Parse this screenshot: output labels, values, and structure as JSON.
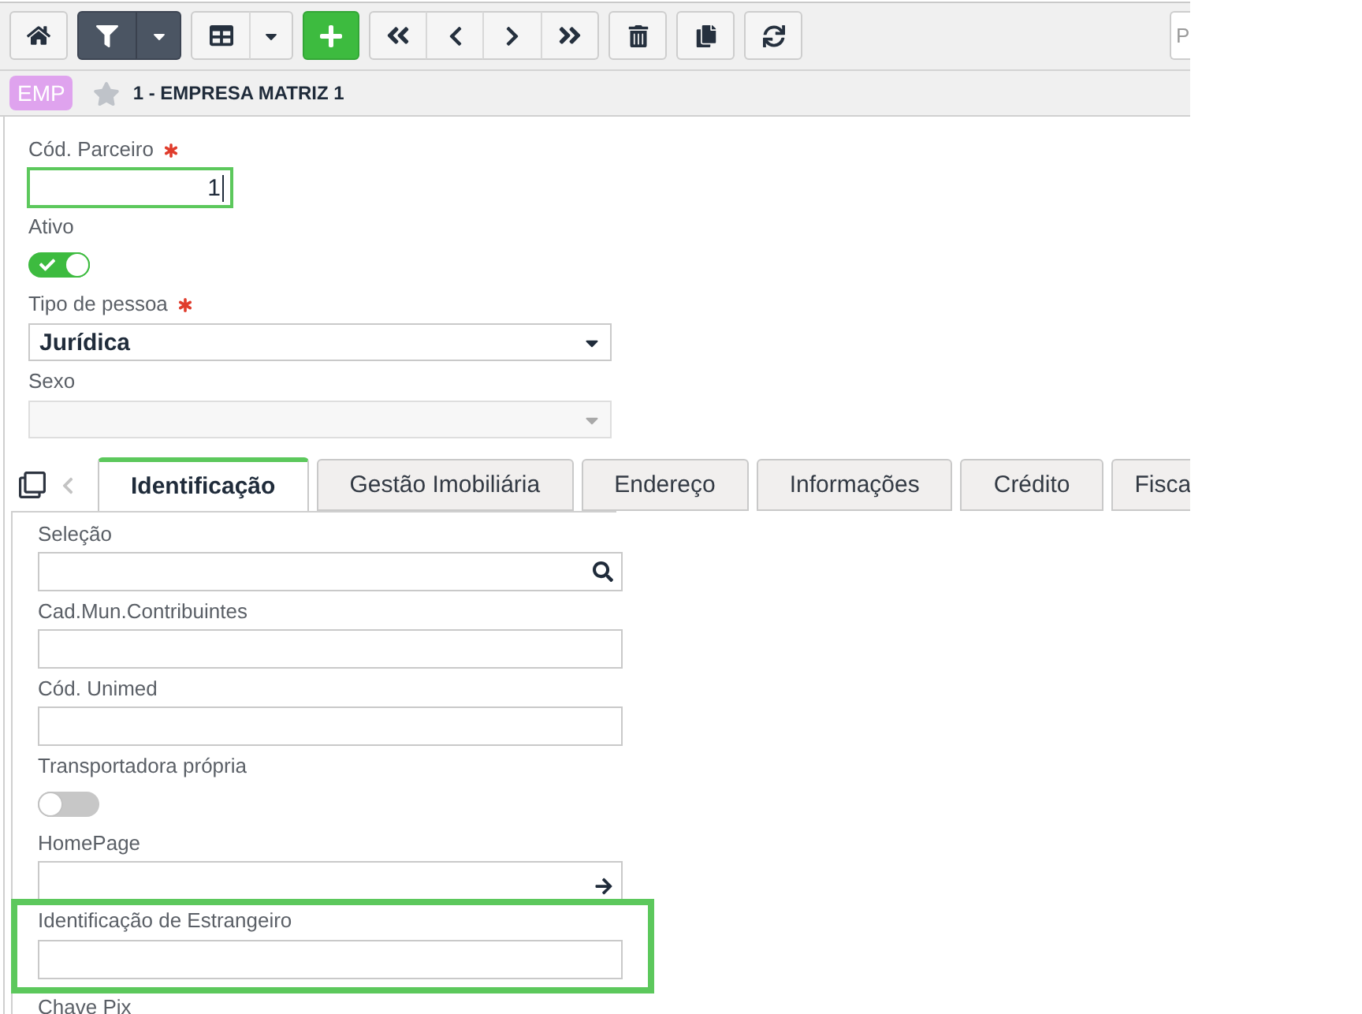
{
  "toolbar": {
    "filter_active": true,
    "search": {
      "placeholder": "P"
    }
  },
  "header": {
    "badge": "EMP",
    "favorite": false,
    "title": "1 - EMPRESA MATRIZ 1"
  },
  "form": {
    "fields": [
      {
        "kind": "text",
        "label": "Cód. Parceiro",
        "required": true,
        "focused": true,
        "value": "1"
      },
      {
        "kind": "toggle",
        "label": "Ativo",
        "required": false,
        "on": true
      },
      {
        "kind": "select",
        "label": "Tipo de pessoa",
        "required": true,
        "disabled": false,
        "value": "Jurídica"
      },
      {
        "kind": "select",
        "label": "Sexo",
        "required": false,
        "disabled": true
      }
    ]
  },
  "tab_strip": {
    "scroll_back_disabled": true,
    "tabs": [
      {
        "label": "Identificação",
        "selected": true
      },
      {
        "label": "Gestão Imobiliária",
        "selected": false
      },
      {
        "label": "Endereço",
        "selected": false
      },
      {
        "label": "Informações",
        "selected": false
      },
      {
        "label": "Crédito",
        "selected": false
      },
      {
        "label": "Fisca",
        "selected": false
      }
    ]
  },
  "tab_panel": {
    "fields": [
      {
        "kind": "lookup",
        "label": "Seleção",
        "highlighted": false
      },
      {
        "kind": "text",
        "label": "Cad.Mun.Contribuintes",
        "highlighted": false
      },
      {
        "kind": "text",
        "label": "Cód. Unimed",
        "highlighted": false
      },
      {
        "kind": "toggle",
        "label": "Transportadora própria",
        "on": false,
        "highlighted": false
      },
      {
        "kind": "link",
        "label": "HomePage",
        "highlighted": false
      },
      {
        "kind": "text",
        "label": "Identificação de Estrangeiro",
        "highlighted": true
      },
      {
        "label": "Chave Pix",
        "highlighted": false
      }
    ]
  }
}
